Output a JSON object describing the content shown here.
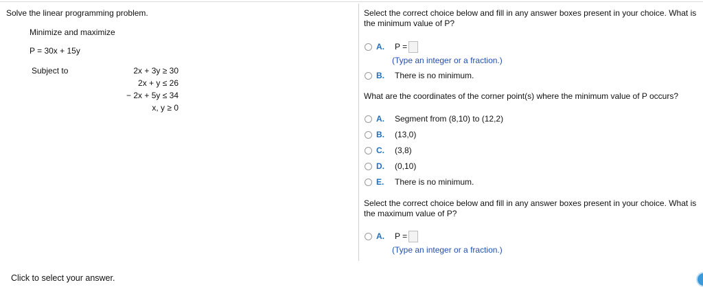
{
  "problem": {
    "title": "Solve the linear programming problem.",
    "minmax": "Minimize and maximize",
    "objective": "P = 30x + 15y",
    "subject_to": "Subject to",
    "constraints": [
      "2x + 3y  ≥  30",
      "2x + y  ≤  26",
      "− 2x + 5y  ≤  34",
      "x, y  ≥  0"
    ]
  },
  "q1": {
    "text": "Select the correct choice below and fill in any answer boxes present in your choice. What is the minimum value of P?",
    "choices": [
      {
        "letter": "A.",
        "text": "P ="
      },
      {
        "letter": "B.",
        "text": "There is no minimum."
      }
    ],
    "hint": "(Type an integer or a fraction.)"
  },
  "q2": {
    "text": "What are the coordinates of the corner point(s) where the minimum value of P occurs?",
    "choices": [
      {
        "letter": "A.",
        "text": "Segment from (8,10) to (12,2)"
      },
      {
        "letter": "B.",
        "text": "(13,0)"
      },
      {
        "letter": "C.",
        "text": "(3,8)"
      },
      {
        "letter": "D.",
        "text": "(0,10)"
      },
      {
        "letter": "E.",
        "text": "There is no minimum."
      }
    ]
  },
  "q3": {
    "text": "Select the correct choice below and fill in any answer boxes present in your choice. What is the maximum value of P?",
    "choices": [
      {
        "letter": "A.",
        "text": "P ="
      }
    ],
    "hint": "(Type an integer or a fraction.)"
  },
  "footer": {
    "status": "Click to select your answer."
  },
  "icons": {
    "radio": "radio-button-icon",
    "help": "help-bubble-icon"
  },
  "colors": {
    "letter": "#1f6fbf",
    "hint": "#1f4fb0",
    "corner_icon": "#3a9ad9"
  }
}
